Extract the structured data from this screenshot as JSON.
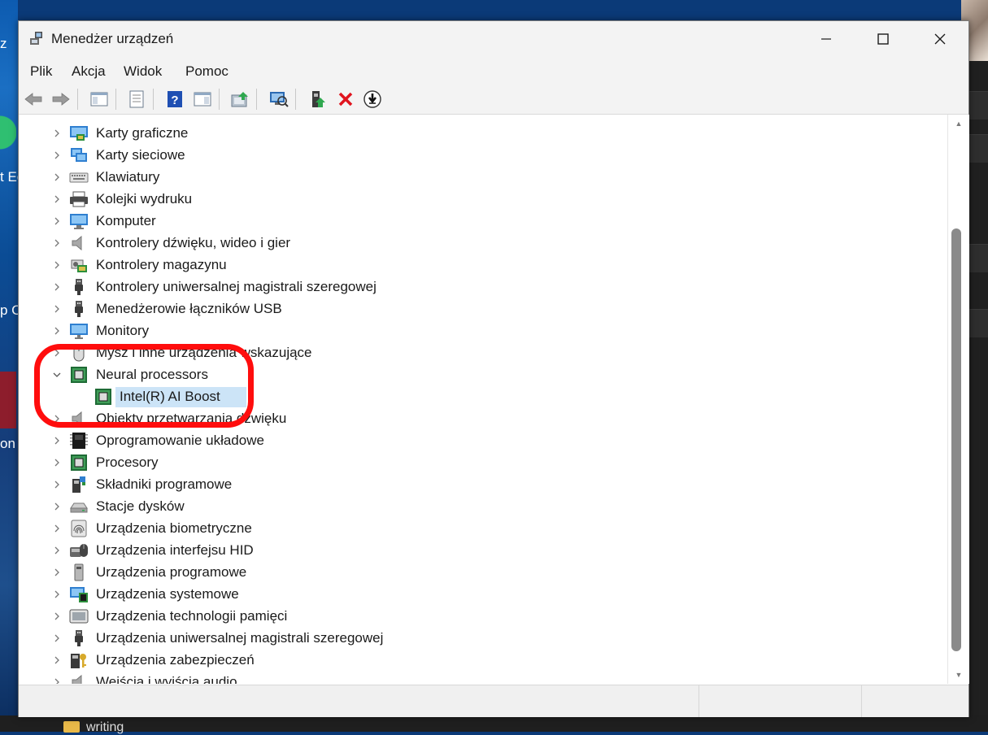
{
  "window": {
    "title": "Menedżer urządzeń",
    "controls": {
      "minimize": "—",
      "maximize": "☐",
      "close": "✕"
    }
  },
  "menu": [
    "Plik",
    "Akcja",
    "Widok",
    "Pomoc"
  ],
  "toolbar": {
    "buttons": [
      "back-arrow-icon",
      "forward-arrow-icon",
      "show-hide-console-tree-icon",
      "properties-icon",
      "help-icon",
      "show-action-pane-icon",
      "update-driver-icon",
      "scan-hardware-icon",
      "enable-device-icon",
      "uninstall-device-icon",
      "download-driver-icon"
    ]
  },
  "tree": {
    "items": [
      {
        "label": "Karty graficzne",
        "icon": "display-adapter-icon",
        "expanded": false
      },
      {
        "label": "Karty sieciowe",
        "icon": "network-adapter-icon",
        "expanded": false
      },
      {
        "label": "Klawiatury",
        "icon": "keyboard-icon",
        "expanded": false
      },
      {
        "label": "Kolejki wydruku",
        "icon": "printer-icon",
        "expanded": false
      },
      {
        "label": "Komputer",
        "icon": "computer-icon",
        "expanded": false
      },
      {
        "label": "Kontrolery dźwięku, wideo i gier",
        "icon": "speaker-icon",
        "expanded": false
      },
      {
        "label": "Kontrolery magazynu",
        "icon": "storage-controller-icon",
        "expanded": false
      },
      {
        "label": "Kontrolery uniwersalnej magistrali szeregowej",
        "icon": "usb-icon",
        "expanded": false
      },
      {
        "label": "Menedżerowie łączników USB",
        "icon": "usb-icon",
        "expanded": false
      },
      {
        "label": "Monitory",
        "icon": "monitor-icon",
        "expanded": false
      },
      {
        "label": "Mysz i inne urządzenia wskazujące",
        "icon": "mouse-icon",
        "expanded": false
      },
      {
        "label": "Neural processors",
        "icon": "chip-icon",
        "expanded": true
      },
      {
        "label": "Intel(R) AI Boost",
        "icon": "chip-icon",
        "child": true,
        "selected": true
      },
      {
        "label": "Obiekty przetwarzania dźwięku",
        "icon": "speaker-icon",
        "expanded": false
      },
      {
        "label": "Oprogramowanie układowe",
        "icon": "firmware-icon",
        "expanded": false
      },
      {
        "label": "Procesory",
        "icon": "chip-icon",
        "expanded": false
      },
      {
        "label": "Składniki programowe",
        "icon": "software-component-icon",
        "expanded": false
      },
      {
        "label": "Stacje dysków",
        "icon": "disk-drive-icon",
        "expanded": false
      },
      {
        "label": "Urządzenia biometryczne",
        "icon": "fingerprint-icon",
        "expanded": false
      },
      {
        "label": "Urządzenia interfejsu HID",
        "icon": "hid-icon",
        "expanded": false
      },
      {
        "label": "Urządzenia programowe",
        "icon": "software-device-icon",
        "expanded": false
      },
      {
        "label": "Urządzenia systemowe",
        "icon": "system-device-icon",
        "expanded": false
      },
      {
        "label": "Urządzenia technologii pamięci",
        "icon": "memory-tech-icon",
        "expanded": false
      },
      {
        "label": "Urządzenia uniwersalnej magistrali szeregowej",
        "icon": "usb-icon",
        "expanded": false
      },
      {
        "label": "Urządzenia zabezpieczeń",
        "icon": "security-device-icon",
        "expanded": false
      },
      {
        "label": "Wejścia i wyjścia audio",
        "icon": "speaker-icon",
        "expanded": false
      }
    ]
  },
  "desktop": {
    "texts": [
      "z",
      "t Ec",
      "p C",
      "on"
    ],
    "taskbar_item": "writing"
  },
  "colors": {
    "highlight_ring": "#ff0d0d",
    "selection": "#cce4f7"
  }
}
